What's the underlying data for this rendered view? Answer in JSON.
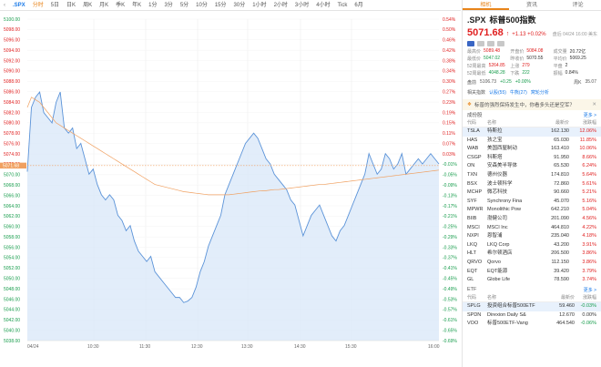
{
  "toolbar": {
    "symbol": ".SPX",
    "items": [
      "分时",
      "5日",
      "日K",
      "周K",
      "月K",
      "季K",
      "年K",
      "1分",
      "3分",
      "5分",
      "10分",
      "15分",
      "30分",
      "1小时",
      "2小时",
      "3小时",
      "4小时",
      "Tick",
      "6月"
    ],
    "active_index": 0,
    "tools": [
      "fullscreen-icon",
      "settings-icon",
      "camera-icon",
      "chevron-icon",
      "close-icon"
    ]
  },
  "chart_data": {
    "type": "line",
    "x_ticks": [
      "04/24",
      "10:30",
      "11:30",
      "12:30",
      "13:30",
      "14:30",
      "15:30",
      "16:00"
    ],
    "left_axis": [
      "5100.00",
      "5098.00",
      "5096.00",
      "5094.00",
      "5092.00",
      "5090.00",
      "5088.00",
      "5086.00",
      "5084.00",
      "5082.00",
      "5080.00",
      "5078.00",
      "5076.00",
      "5074.00",
      "5072.00",
      "5070.00",
      "5068.00",
      "5066.00",
      "5064.00",
      "5062.00",
      "5060.00",
      "5058.00",
      "5056.00",
      "5054.00",
      "5052.00",
      "5050.00",
      "5048.00",
      "5046.00",
      "5044.00",
      "5042.00",
      "5040.00",
      "5038.00"
    ],
    "right_axis": [
      "0.54%",
      "0.50%",
      "0.46%",
      "0.42%",
      "0.38%",
      "0.34%",
      "0.30%",
      "0.27%",
      "0.23%",
      "0.19%",
      "0.15%",
      "0.11%",
      "0.07%",
      "0.03%",
      "-0.01%",
      "-0.05%",
      "-0.09%",
      "-0.13%",
      "-0.17%",
      "-0.21%",
      "-0.25%",
      "-0.29%",
      "-0.33%",
      "-0.37%",
      "-0.41%",
      "-0.45%",
      "-0.49%",
      "-0.53%",
      "-0.57%",
      "-0.61%",
      "-0.65%",
      "-0.69%"
    ],
    "prev_close_label": "5071.68",
    "prev_close": 5071.68,
    "ylim": [
      5037.6,
      5100.2
    ],
    "price_series": [
      5070.5,
      5083,
      5085,
      5086,
      5082,
      5081,
      5080,
      5084,
      5086,
      5079,
      5078,
      5079,
      5075,
      5076,
      5073,
      5070,
      5071,
      5068,
      5066,
      5065,
      5066,
      5065,
      5062,
      5061,
      5059,
      5060,
      5057,
      5055,
      5054,
      5053,
      5054,
      5051,
      5050,
      5049,
      5048,
      5047,
      5046,
      5046,
      5045,
      5045.3,
      5046,
      5048,
      5051,
      5053,
      5056,
      5058,
      5060,
      5062,
      5066,
      5068,
      5070,
      5072,
      5074,
      5076,
      5077,
      5078,
      5077,
      5075,
      5073,
      5072,
      5070,
      5069,
      5068,
      5067,
      5065,
      5064,
      5061,
      5058,
      5060,
      5062,
      5063,
      5064,
      5062,
      5060,
      5058,
      5057,
      5059,
      5060,
      5062,
      5064,
      5066,
      5068,
      5070,
      5074,
      5072,
      5070,
      5071,
      5074,
      5073,
      5071,
      5072,
      5074,
      5070,
      5071,
      5072,
      5073,
      5072,
      5073,
      5074,
      5073,
      5072
    ],
    "avg_series": [
      5083,
      5085,
      5084.5,
      5084,
      5083,
      5082,
      5081,
      5080,
      5079.5,
      5079,
      5078.5,
      5078,
      5077.5,
      5077,
      5076.5,
      5076,
      5075.5,
      5075,
      5074.5,
      5074,
      5073.5,
      5073,
      5072.5,
      5072,
      5071.5,
      5071,
      5070.5,
      5070,
      5069.5,
      5069,
      5068.5,
      5068,
      5067.8,
      5067.6,
      5067.4,
      5067.2,
      5067,
      5066.8,
      5066.6,
      5066.5,
      5066.4,
      5066.3,
      5066.2,
      5066.1,
      5066,
      5066,
      5066,
      5066,
      5066,
      5066,
      5066.1,
      5066.2,
      5066.3,
      5066.4,
      5066.5,
      5066.6,
      5066.7,
      5066.8,
      5066.8,
      5066.9,
      5067,
      5067,
      5067.1,
      5067.2,
      5067.3,
      5067.4,
      5067.5,
      5067.6,
      5067.7,
      5067.8,
      5067.9,
      5068,
      5068,
      5068.1,
      5068.2,
      5068.3,
      5068.4,
      5068.5,
      5068.6,
      5068.7,
      5068.8,
      5068.9,
      5069,
      5069.1,
      5069.2,
      5069.3,
      5069.4,
      5069.5,
      5069.6,
      5069.7,
      5069.8,
      5069.9,
      5070,
      5070.1,
      5070.2,
      5070.3,
      5070.4,
      5070.5,
      5070.6,
      5070.7,
      5070.8
    ],
    "colors": {
      "price": "#5b93d8",
      "avg": "#f0a060",
      "fill": "#d8e7f8",
      "prev": "#f0a060",
      "up": "#e02020",
      "down": "#169c4b"
    }
  },
  "panel": {
    "tabs": [
      "相机",
      "资讯",
      "评论"
    ],
    "active_tab": 0,
    "symbol": ".SPX",
    "name": "标普500指数",
    "price": "5071.68",
    "change": "+1.13 +0.02%",
    "time": "盘后 04/24 16:00 美东",
    "stats": [
      {
        "k": "最高价",
        "v": "5089.48",
        "c": "red"
      },
      {
        "k": "开盘价",
        "v": "5084.08",
        "c": "red"
      },
      {
        "k": "成交量",
        "v": "20.72亿",
        "c": ""
      },
      {
        "k": "最低价",
        "v": "5047.02",
        "c": "green"
      },
      {
        "k": "昨收价",
        "v": "5070.55",
        "c": ""
      },
      {
        "k": "平均价",
        "v": "5069.25",
        "c": ""
      },
      {
        "k": "52周最高",
        "v": "5264.85",
        "c": "red"
      },
      {
        "k": "上涨",
        "v": "279",
        "c": "red"
      },
      {
        "k": "平盘",
        "v": "2",
        "c": ""
      },
      {
        "k": "52周最低",
        "v": "4048.28",
        "c": "green"
      },
      {
        "k": "下跌",
        "v": "222",
        "c": "green"
      },
      {
        "k": "振幅",
        "v": "0.84%",
        "c": ""
      }
    ],
    "after_hours": {
      "label": "盘前",
      "price": "5106.73",
      "change": "+0.25",
      "pct": "+0.00%",
      "extra_label": "周K",
      "extra_value": "35.07"
    },
    "related": {
      "label": "相关指数",
      "links": [
        "认股(55)",
        "牛熊(27)",
        "窝轮分析"
      ]
    },
    "banner": "标普的强烈保持发生中，你看多头还是空军？",
    "constituents_title": "成份股",
    "constituents_more": "更多 >",
    "col_headers": [
      "代码",
      "名称",
      "最新价",
      "涨跌幅"
    ],
    "constituents": [
      {
        "code": "TSLA",
        "name": "特斯拉",
        "price": "162.130",
        "pct": "12.06%"
      },
      {
        "code": "HAS",
        "name": "孩之宝",
        "price": "65.030",
        "pct": "11.85%"
      },
      {
        "code": "WAB",
        "name": "美国西屋制动",
        "price": "163.410",
        "pct": "10.06%"
      },
      {
        "code": "CSGP",
        "name": "科斯塔",
        "price": "91.950",
        "pct": "8.66%"
      },
      {
        "code": "ON",
        "name": "安森美半导体",
        "price": "65.530",
        "pct": "6.24%"
      },
      {
        "code": "TXN",
        "name": "德州仪器",
        "price": "174.810",
        "pct": "5.64%"
      },
      {
        "code": "BSX",
        "name": "波士顿科学",
        "price": "72.860",
        "pct": "5.61%"
      },
      {
        "code": "MCHP",
        "name": "微芯科技",
        "price": "90.660",
        "pct": "5.21%"
      },
      {
        "code": "SYF",
        "name": "Synchrony Fina",
        "price": "45.070",
        "pct": "5.16%"
      },
      {
        "code": "MPWR",
        "name": "Monolithic Pow",
        "price": "642.210",
        "pct": "5.04%"
      },
      {
        "code": "BIIB",
        "name": "渤健公司",
        "price": "201.090",
        "pct": "4.56%"
      },
      {
        "code": "MSCI",
        "name": "MSCI Inc",
        "price": "464.810",
        "pct": "4.22%"
      },
      {
        "code": "NXPI",
        "name": "恩智浦",
        "price": "235.040",
        "pct": "4.18%"
      },
      {
        "code": "LKQ",
        "name": "LKQ Corp",
        "price": "43.200",
        "pct": "3.91%"
      },
      {
        "code": "HLT",
        "name": "希尔顿酒店",
        "price": "206.500",
        "pct": "3.86%"
      },
      {
        "code": "QRVO",
        "name": "Qorvo",
        "price": "112.150",
        "pct": "3.86%"
      },
      {
        "code": "EQT",
        "name": "EQT能源",
        "price": "39.420",
        "pct": "3.79%"
      },
      {
        "code": "GL",
        "name": "Globe Life",
        "price": "78.590",
        "pct": "3.74%"
      }
    ],
    "etf_title": "ETF",
    "etf_more": "更多 >",
    "etf_headers": [
      "代码",
      "名称",
      "最新价",
      "涨跌幅"
    ],
    "etfs": [
      {
        "code": "SPLG",
        "name": "投资组合标普500ETF",
        "price": "59.460",
        "pct": "-0.03%",
        "c": "green"
      },
      {
        "code": "SPDN",
        "name": "Direxion Daily S&",
        "price": "12.670",
        "pct": "0.00%",
        "c": ""
      },
      {
        "code": "VOO",
        "name": "标普500ETF-Vang",
        "price": "464.540",
        "pct": "-0.06%",
        "c": "green"
      }
    ]
  }
}
